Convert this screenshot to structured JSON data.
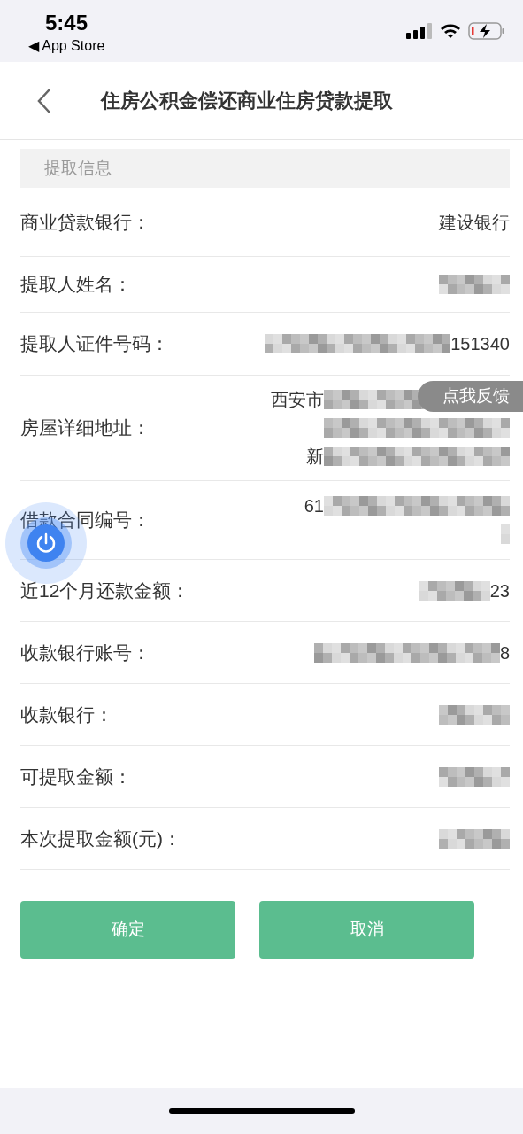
{
  "status_bar": {
    "time": "5:45",
    "back_app": "◀ App Store"
  },
  "header": {
    "title": "住房公积金偿还商业住房贷款提取"
  },
  "section": {
    "title": "提取信息"
  },
  "rows": [
    {
      "label": "商业贷款银行：",
      "lines": [
        [
          {
            "kind": "text",
            "text": "建设银行"
          }
        ]
      ]
    },
    {
      "label": "提取人姓名：",
      "lines": [
        [
          {
            "kind": "redacted-short"
          }
        ]
      ]
    },
    {
      "label": "提取人证件号码：",
      "lines": [
        [
          {
            "kind": "redacted-long"
          },
          {
            "kind": "text",
            "text": "151340"
          }
        ]
      ]
    },
    {
      "label": "房屋详细地址：",
      "lines": [
        [
          {
            "kind": "text",
            "text": "西安市"
          },
          {
            "kind": "redacted-long"
          }
        ],
        [
          {
            "kind": "redacted-long"
          }
        ],
        [
          {
            "kind": "text",
            "text": "新"
          },
          {
            "kind": "redacted-long"
          }
        ]
      ]
    },
    {
      "label": "借款合同编号：",
      "lines": [
        [
          {
            "kind": "text",
            "text": "61"
          },
          {
            "kind": "redacted-long"
          }
        ],
        [
          {
            "kind": "redacted-tiny"
          }
        ]
      ]
    },
    {
      "label": "近12个月还款金额：",
      "lines": [
        [
          {
            "kind": "redacted-short"
          },
          {
            "kind": "text",
            "text": "23"
          }
        ]
      ]
    },
    {
      "label": "收款银行账号：",
      "lines": [
        [
          {
            "kind": "redacted-long"
          },
          {
            "kind": "text",
            "text": "8"
          }
        ]
      ]
    },
    {
      "label": "收款银行：",
      "lines": [
        [
          {
            "kind": "redacted-short"
          }
        ]
      ]
    },
    {
      "label": "可提取金额：",
      "lines": [
        [
          {
            "kind": "redacted-short"
          }
        ]
      ]
    },
    {
      "label": "本次提取金额(元)：",
      "lines": [
        [
          {
            "kind": "redacted-short"
          }
        ]
      ]
    }
  ],
  "buttons": [
    {
      "label": "确定"
    },
    {
      "label": "取消"
    }
  ],
  "feedback_tab": {
    "label": "点我反馈"
  }
}
